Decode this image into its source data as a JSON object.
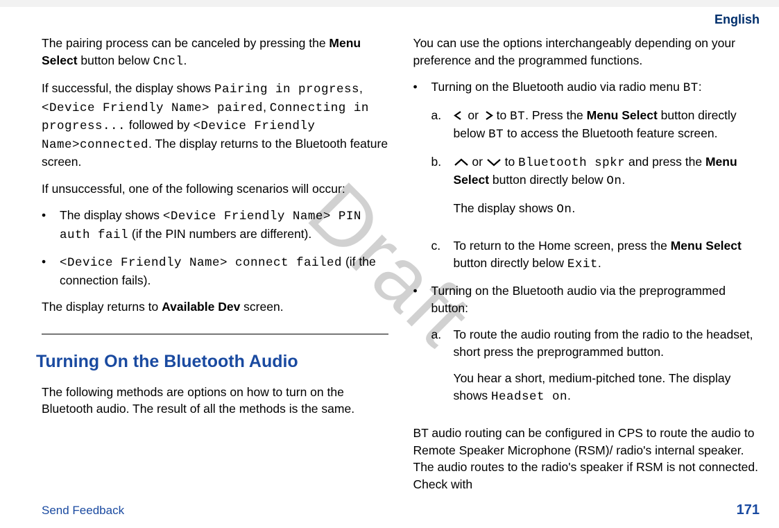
{
  "header": {
    "language": "English"
  },
  "watermark": "Draft",
  "footer": {
    "send_feedback": "Send Feedback",
    "page_number": "171"
  },
  "col1": {
    "p1_a": "The pairing process can be canceled by pressing the ",
    "p1_b": "Menu Select",
    "p1_c": " button below ",
    "p1_d": "Cncl",
    "p1_e": ".",
    "p2_a": "If successful, the display shows ",
    "p2_b": "Pairing in progress",
    "p2_c": ",",
    "p2_d": "<Device Friendly Name> paired",
    "p2_e": ", ",
    "p2_f": "Connecting in progress...",
    "p2_g": " followed by ",
    "p2_h": "<Device Friendly Name>connected",
    "p2_i": ". The display returns to the Bluetooth feature screen.",
    "p3": "If unsuccessful, one of the following scenarios will occur:",
    "b1_a": "The display shows ",
    "b1_b": "<Device Friendly Name> PIN auth fail",
    "b1_c": " (if the PIN numbers are different).",
    "b2_a": "<Device Friendly Name> connect failed",
    "b2_b": " (if the connection fails).",
    "p4_a": "The display returns to ",
    "p4_b": "Available Dev",
    "p4_c": " screen.",
    "h2": "Turning On the Bluetooth Audio",
    "p5": "The following methods are options on how to turn on the Bluetooth audio. The result of all the methods is the same."
  },
  "col2": {
    "p1": "You can use the options interchangeably depending on your preference and the programmed functions.",
    "b1_a": "Turning on the Bluetooth audio via radio menu ",
    "b1_b": "BT",
    "b1_c": ":",
    "a_marker": "a.",
    "a_txt_1": " or ",
    "a_txt_2": " to ",
    "a_txt_3": "BT",
    "a_txt_4": ". Press the ",
    "a_txt_5": "Menu Select",
    "a_txt_6": " button directly below ",
    "a_txt_7": "BT",
    "a_txt_8": " to access the Bluetooth feature screen.",
    "b_marker": "b.",
    "b_txt_1": " or ",
    "b_txt_2": " to ",
    "b_txt_3": "Bluetooth spkr",
    "b_txt_4": " and press the ",
    "b_txt_5": "Menu Select",
    "b_txt_6": " button directly below ",
    "b_txt_7": "On",
    "b_txt_8": ".",
    "b_p2_a": "The display shows ",
    "b_p2_b": "On",
    "b_p2_c": ".",
    "c_marker": "c.",
    "c_txt_1": "To return to the Home screen, press the ",
    "c_txt_2": "Menu Select",
    "c_txt_3": " button directly below ",
    "c_txt_4": "Exit",
    "c_txt_5": ".",
    "b2": "Turning on the Bluetooth audio via the preprogrammed button:",
    "a2_marker": "a.",
    "a2_txt": "To route the audio routing from the radio to the headset, short press the preprogrammed button.",
    "a2_p2_a": "You hear a short, medium-pitched tone. The display shows ",
    "a2_p2_b": "Headset on",
    "a2_p2_c": ".",
    "p_last": "BT audio routing can be configured in CPS to route the audio to Remote Speaker Microphone (RSM)/ radio's internal speaker. The audio routes to the radio's speaker if RSM is not connected. Check with"
  }
}
